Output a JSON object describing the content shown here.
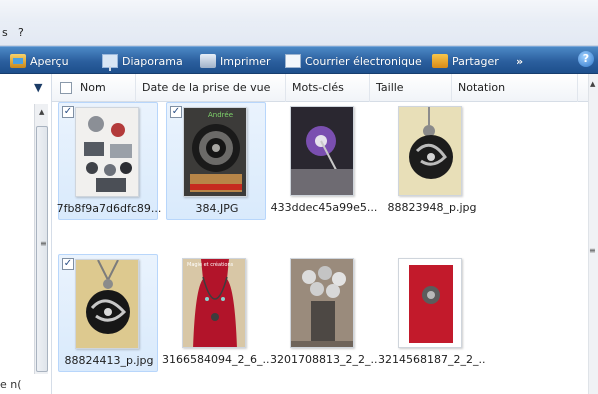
{
  "menu": {
    "items": [
      "s",
      "?"
    ]
  },
  "toolbar": {
    "buttons": [
      {
        "label": "Aperçu",
        "icon": "preview-icon"
      },
      {
        "label": "Diaporama",
        "icon": "slideshow-icon"
      },
      {
        "label": "Imprimer",
        "icon": "print-icon"
      },
      {
        "label": "Courrier électronique",
        "icon": "mail-icon"
      },
      {
        "label": "Partager",
        "icon": "share-icon"
      }
    ],
    "overflow": "»",
    "help": "?"
  },
  "columns": [
    "Nom",
    "Date de la prise de vue",
    "Mots-clés",
    "Taille",
    "Notation"
  ],
  "files": [
    {
      "name": "7fb8f9a7d6dfc89...",
      "checked": true,
      "selected": true
    },
    {
      "name": "384.JPG",
      "checked": true,
      "selected": true
    },
    {
      "name": "433ddec45a99e5...",
      "checked": false,
      "selected": false
    },
    {
      "name": "88823948_p.jpg",
      "checked": false,
      "selected": false
    },
    {
      "name": "88824413_p.jpg",
      "checked": true,
      "selected": true
    },
    {
      "name": "3166584094_2_6_...",
      "checked": false,
      "selected": false
    },
    {
      "name": "3201708813_2_2_...",
      "checked": false,
      "selected": false
    },
    {
      "name": "3214568187_2_2_...",
      "checked": false,
      "selected": false
    }
  ],
  "thumbnail_text": {
    "tile_2_caption": "Andrée",
    "tile_6_caption": "Magie et créations"
  },
  "nav": {
    "truncated_label": "e n("
  },
  "colors": {
    "accent": "#2b5f9e",
    "selection": "#d9eafc"
  }
}
